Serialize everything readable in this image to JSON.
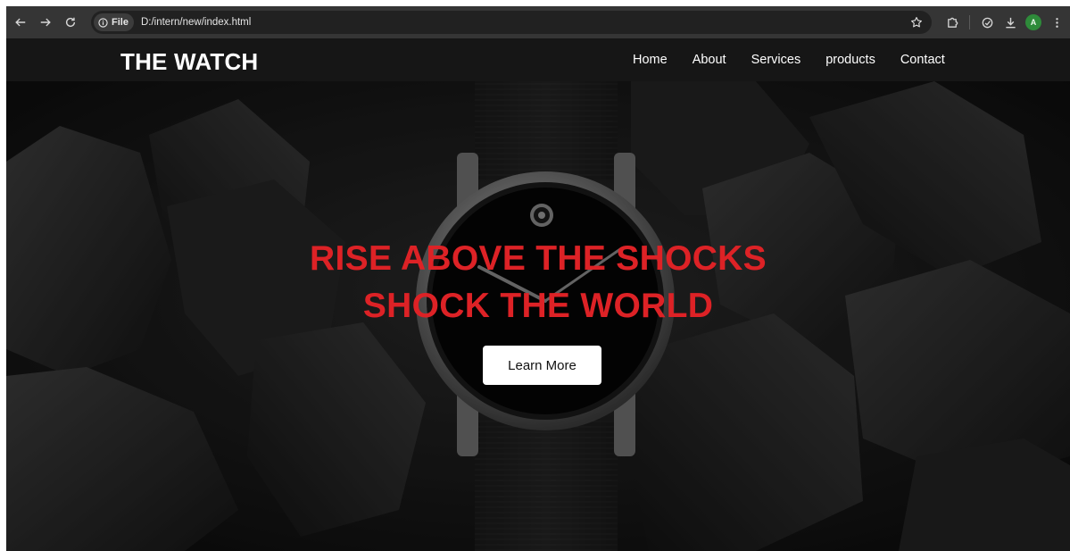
{
  "browser": {
    "site_chip_label": "File",
    "url": "D:/intern/new/index.html",
    "profile_initial": "A"
  },
  "site": {
    "brand": "THE WATCH",
    "nav": [
      {
        "label": "Home"
      },
      {
        "label": "About"
      },
      {
        "label": "Services"
      },
      {
        "label": "products"
      },
      {
        "label": "Contact"
      }
    ]
  },
  "hero": {
    "headline_line1": "RISE ABOVE THE SHOCKS",
    "headline_line2": "SHOCK THE WORLD",
    "cta_label": "Learn More"
  },
  "colors": {
    "headline": "#dd2226",
    "header_bg": "#161616",
    "chrome_bg": "#353535",
    "cta_bg": "#ffffff"
  }
}
